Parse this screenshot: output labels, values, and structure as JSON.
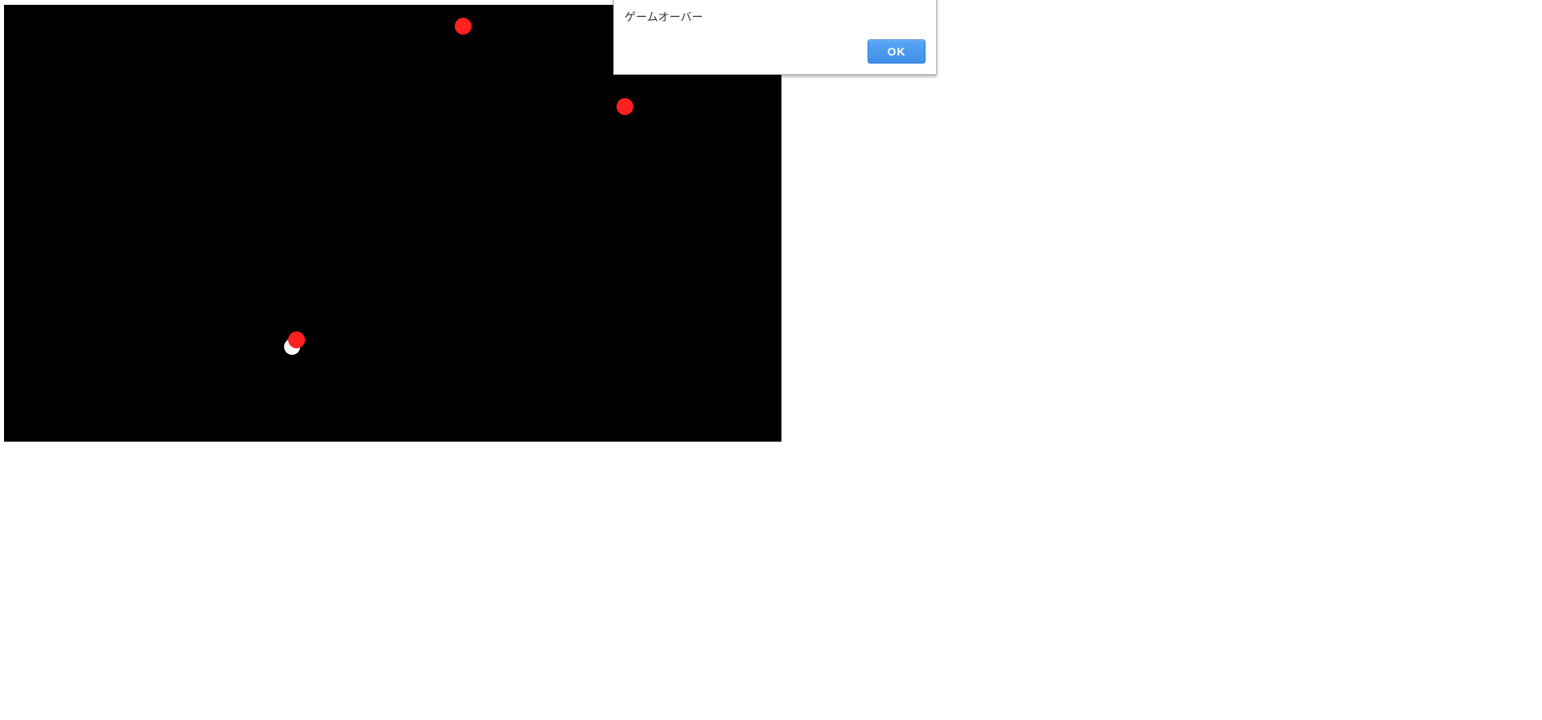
{
  "game": {
    "background_color": "#000000",
    "enemies": [
      {
        "name": "enemy-ball",
        "color": "#ff2020"
      },
      {
        "name": "enemy-ball",
        "color": "#ff2020"
      },
      {
        "name": "enemy-ball",
        "color": "#ff2020"
      }
    ],
    "player": {
      "name": "player-ball",
      "color": "#ffffff"
    }
  },
  "alert": {
    "message": "ゲームオーバー",
    "ok_label": "OK",
    "button_color": "#4a9af0"
  }
}
